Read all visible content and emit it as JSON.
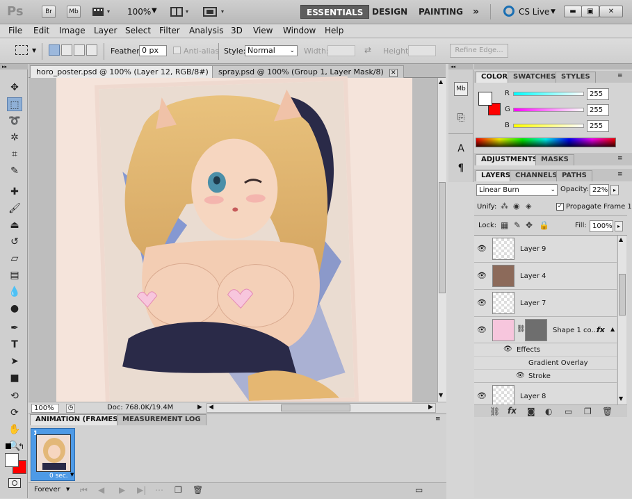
{
  "appbar": {
    "logo": "Ps",
    "bridge": "Br",
    "minibridge": "Mb",
    "zoom": "100%",
    "workspaces": [
      "ESSENTIALS",
      "DESIGN",
      "PAINTING"
    ],
    "more": "»",
    "cslive": "CS Live"
  },
  "menu": [
    "File",
    "Edit",
    "Image",
    "Layer",
    "Select",
    "Filter",
    "Analysis",
    "3D",
    "View",
    "Window",
    "Help"
  ],
  "options": {
    "feather_label": "Feather:",
    "feather_value": "0 px",
    "antialias_label": "Anti-alias",
    "style_label": "Style:",
    "style_value": "Normal",
    "width_label": "Width:",
    "height_label": "Height:",
    "refine_label": "Refine Edge..."
  },
  "doc_tabs": [
    {
      "title": "horo_poster.psd @ 100% (Layer 12, RGB/8#)",
      "close": "✕"
    },
    {
      "title": "spray.psd @ 100% (Group 1, Layer Mask/8)",
      "close": "✕"
    }
  ],
  "status": {
    "zoom": "100%",
    "doc": "Doc: 768.0K/19.4M"
  },
  "animation": {
    "tabs": [
      "ANIMATION (FRAMES)",
      "MEASUREMENT LOG"
    ],
    "frame_number": "1",
    "frame_delay": "0 sec.",
    "loop": "Forever"
  },
  "color_panel": {
    "tabs": [
      "COLOR",
      "SWATCHES",
      "STYLES"
    ],
    "channels": [
      {
        "label": "R",
        "value": "255",
        "color": "#00e5ff"
      },
      {
        "label": "G",
        "value": "255",
        "color": "#ff00ff"
      },
      {
        "label": "B",
        "value": "255",
        "color": "#ffff00"
      }
    ],
    "foreground": "#ffffff",
    "background": "#ff0000"
  },
  "adjustments_tabs": [
    "ADJUSTMENTS",
    "MASKS"
  ],
  "layers_panel": {
    "tabs": [
      "LAYERS",
      "CHANNELS",
      "PATHS"
    ],
    "blend_mode": "Linear Burn",
    "opacity_label": "Opacity:",
    "opacity": "22%",
    "unify_label": "Unify:",
    "propagate_label": "Propagate Frame 1",
    "lock_label": "Lock:",
    "fill_label": "Fill:",
    "fill": "100%",
    "layers": [
      {
        "name": "Layer 9"
      },
      {
        "name": "Layer 4"
      },
      {
        "name": "Layer 7"
      },
      {
        "name": "Shape 1 co..."
      },
      {
        "name": "Layer 8"
      }
    ],
    "effects_label": "Effects",
    "effect_items": [
      "Gradient Overlay",
      "Stroke"
    ],
    "fx": "fx"
  }
}
